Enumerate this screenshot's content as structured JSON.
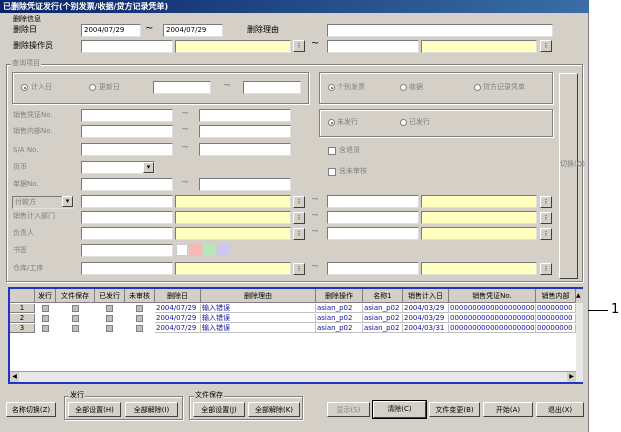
{
  "window": {
    "title": "已删除凭证发行(个别发票/收据/贷方记录凭单)"
  },
  "deleted_info": {
    "group_label": "删除信息",
    "date_label": "删除日",
    "date_from": "2004/07/29",
    "date_to": "2004/07/29",
    "tilde": "~",
    "reason_label": "删除理由",
    "reason_value": "",
    "operator_label": "删除操作员",
    "operator_from": "",
    "operator_to": "",
    "dots": "⁝"
  },
  "query": {
    "group_label": "查询项目",
    "radio_entry_date": "计入日",
    "radio_update_date": "更新日",
    "radio_individual": "个别发票",
    "radio_receipt": "收据",
    "radio_credit": "贷方记录凭单",
    "labels": [
      "销售凭证No.",
      "销售内部No.",
      "S/A No.",
      "货币",
      "单据No.",
      "付款方",
      "销售计入部门",
      "负责人",
      "书签",
      "仓库/工序"
    ],
    "radio_unissued": "未发行",
    "radio_issued": "已发行",
    "chk_return": "含退货",
    "chk_unreviewed": "含未审核",
    "switch_button": "切换(Q)",
    "payer_select": "付款方"
  },
  "grid": {
    "columns": [
      "",
      "发行",
      "文件保存",
      "已发行",
      "未审核",
      "删除日",
      "删除理由",
      "删除操作",
      "名称1",
      "销售计入日",
      "销售凭证No.",
      "销售内部"
    ],
    "rows": [
      {
        "no": "1",
        "date": "2004/07/29",
        "reason": "输入错误",
        "op": "asian_p02",
        "name": "asian_p02",
        "sdate": "2004/03/29",
        "vno": "00000000000000000001",
        "ino": "00000000"
      },
      {
        "no": "2",
        "date": "2004/07/29",
        "reason": "输入错误",
        "op": "asian_p02",
        "name": "asian_p02",
        "sdate": "2004/03/29",
        "vno": "00000000000000000002",
        "ino": "00000000"
      },
      {
        "no": "3",
        "date": "2004/07/29",
        "reason": "输入错误",
        "op": "asian_p02",
        "name": "asian_p02",
        "sdate": "2004/03/31",
        "vno": "00000000000000000003",
        "ino": "00000000"
      }
    ]
  },
  "footer": {
    "name_switch": "名称切换(Z)",
    "issue_group": "发行",
    "issue_set_all": "全部设置(H)",
    "issue_clear_all": "全部解除(I)",
    "save_group": "文件保存",
    "save_set_all": "全部设置(J)",
    "save_clear_all": "全部解除(K)",
    "show": "显示(S)",
    "clear": "清除(C)",
    "file_change": "文件变更(B)",
    "start": "开始(A)",
    "exit": "退出(X)"
  },
  "annotation": {
    "number": "1"
  },
  "colors": {
    "highlight_border": "#2233cc",
    "required_field": "#ffffc0",
    "cell_text": "#1010a0"
  }
}
